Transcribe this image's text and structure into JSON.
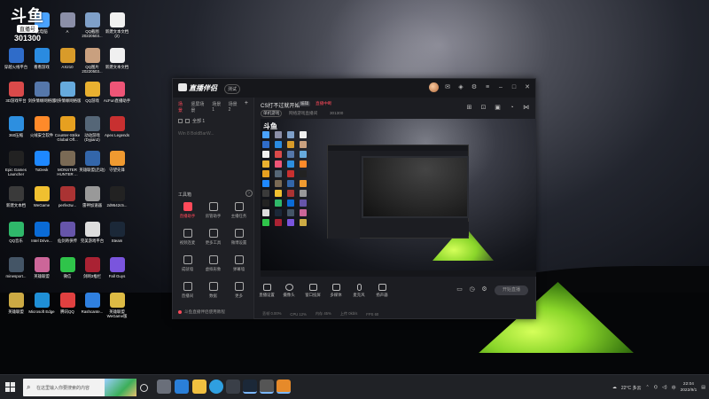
{
  "watermark": {
    "logo_text": "斗鱼",
    "sub_text": "直播号",
    "room_number": "301300"
  },
  "desktop_icons": [
    {
      "label": "此电脑",
      "color": "#4aa3ff"
    },
    {
      "label": "A",
      "color": "#8b8fa8"
    },
    {
      "label": "QQ截图20220503...",
      "color": "#7fa0c9"
    },
    {
      "label": "新建文本文档 (2)",
      "color": "#f0f0f0"
    },
    {
      "label": "穿越火线平台",
      "color": "#2f6cc9"
    },
    {
      "label": "看看游戏",
      "color": "#2a8be0"
    },
    {
      "label": "AX210",
      "color": "#d89b2a"
    },
    {
      "label": "QQ图片20220503...",
      "color": "#c9a07f"
    },
    {
      "label": "新建文本文档",
      "color": "#f0f0f0"
    },
    {
      "label": "3D游戏平台",
      "color": "#d94a4a"
    },
    {
      "label": "剑侠情缘网络版",
      "color": "#5577aa"
    },
    {
      "label": "剑侠情缘网络版",
      "color": "#66aadd"
    },
    {
      "label": "QQ游戏",
      "color": "#e8b030"
    },
    {
      "label": "AcFun直播助手",
      "color": "#ee5577"
    },
    {
      "label": "360压缩",
      "color": "#2d8fe0"
    },
    {
      "label": "火绒安全软件",
      "color": "#ff8a2a"
    },
    {
      "label": "Counter-Strike Global Off...",
      "color": "#e6a020"
    },
    {
      "label": "动动游戏 (Dyjian2)",
      "color": "#556677"
    },
    {
      "label": "Apex Legends",
      "color": "#c83030"
    },
    {
      "label": "Epic Games Launcher",
      "color": "#222222"
    },
    {
      "label": "ToDesk",
      "color": "#1e88ff"
    },
    {
      "label": "MONSTER HUNTER ...",
      "color": "#7a6a55"
    },
    {
      "label": "英雄联盟(启动)",
      "color": "#3366aa"
    },
    {
      "label": "守望先锋",
      "color": "#f09a30"
    },
    {
      "label": "新建文本档",
      "color": "#3a3a3a"
    },
    {
      "label": "WeGame",
      "color": "#f0c030"
    },
    {
      "label": "perfectw...",
      "color": "#aa3333"
    },
    {
      "label": "雷神加速器",
      "color": "#999999"
    },
    {
      "label": "2d9542c5...",
      "color": "#222222"
    },
    {
      "label": "QQ音乐",
      "color": "#2fb86a"
    },
    {
      "label": "Intel Drive...",
      "color": "#0a6bd6"
    },
    {
      "label": "仙剑奇侠传",
      "color": "#6655aa"
    },
    {
      "label": "完美游戏平台",
      "color": "#dddddd"
    },
    {
      "label": "Steam",
      "color": "#1b2838"
    },
    {
      "label": "minesport...",
      "color": "#445566"
    },
    {
      "label": "英雄联盟",
      "color": "#cc6699"
    },
    {
      "label": "微信",
      "color": "#2fc44a"
    },
    {
      "label": "剑网3推栏",
      "color": "#aa2233"
    },
    {
      "label": "Fall Guys",
      "color": "#7a55dd"
    },
    {
      "label": "英雄联盟",
      "color": "#ccaa44"
    },
    {
      "label": "Microsoft Edge",
      "color": "#1f8fd6"
    },
    {
      "label": "腾讯QQ",
      "color": "#e04040"
    },
    {
      "label": "Rashcante...",
      "color": "#2f80e0"
    },
    {
      "label": "英雄联盟WeGame版",
      "color": "#ddbb44"
    }
  ],
  "app": {
    "logo": "直播伴侣",
    "version": "测试",
    "scene_tabs": [
      "场景",
      "竖屏场景",
      "场景 1",
      "场景 2"
    ],
    "sources_label": "全部 1",
    "source_item": "Win 8 BoldBarW...",
    "tools_title": "工具箱",
    "tools": [
      {
        "label": "直播助手",
        "highlight": true
      },
      {
        "label": "房管助手",
        "highlight": false
      },
      {
        "label": "主播任务",
        "highlight": false
      },
      {
        "label": "视频连麦",
        "highlight": false
      },
      {
        "label": "更多工具",
        "highlight": false
      },
      {
        "label": "微博设置",
        "highlight": false
      },
      {
        "label": "成就墙",
        "highlight": false
      },
      {
        "label": "虚拟形象",
        "highlight": false
      },
      {
        "label": "弹幕墙",
        "highlight": false
      },
      {
        "label": "直播间",
        "highlight": false
      },
      {
        "label": "数据",
        "highlight": false
      },
      {
        "label": "更多",
        "highlight": false
      }
    ],
    "footer_text": "斗鱼直播伴侣使用教程",
    "stream_title": "CS打不过就开始",
    "edit_label": "编辑",
    "status_text": "直播中断",
    "category": "单机游戏",
    "category_sub": "网络游戏直播间",
    "room_id": "301300",
    "controls": [
      "直播设置",
      "摄像头",
      "窗口投屏",
      "多媒体",
      "麦克风",
      "扬声器"
    ],
    "start_label": "开始直播",
    "status_items": [
      "丢帧 0.00%",
      "CPU 12%",
      "内存 45%",
      "上传 0kb/s",
      "FPS 60"
    ]
  },
  "taskbar": {
    "search_placeholder": "在这里输入你要搜索的内容",
    "weather": "22°C 多云",
    "input_method": "中",
    "time": "22:04",
    "date": "2022/9/1"
  },
  "colors": {
    "accent": "#ff4a5a",
    "window_bg": "#1c1d22",
    "taskbar": "#202226"
  }
}
